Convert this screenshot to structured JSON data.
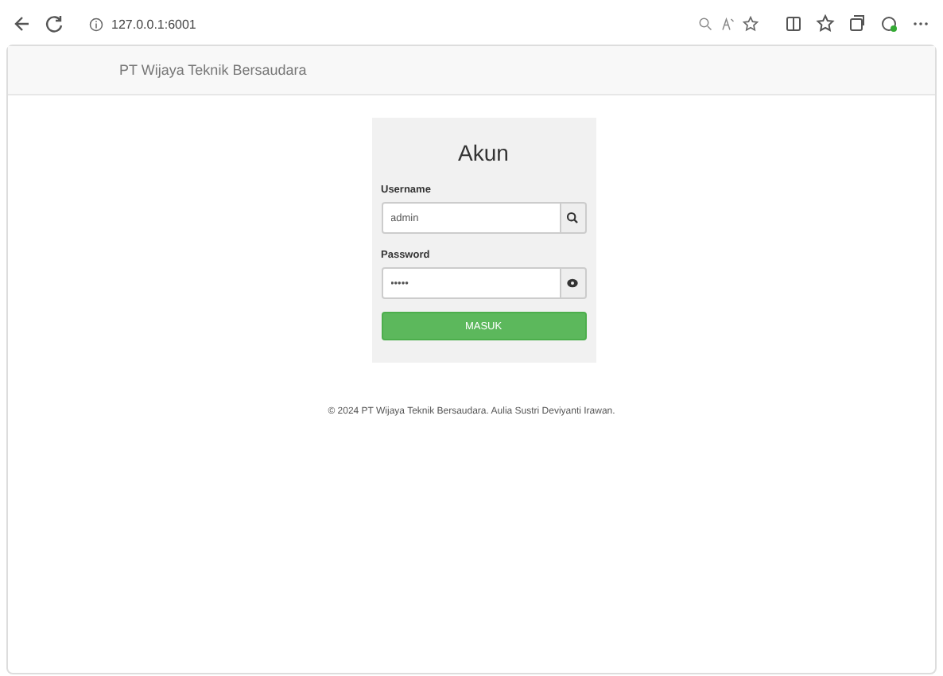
{
  "browser": {
    "address": "127.0.0.1:6001"
  },
  "navbar": {
    "brand": "PT Wijaya Teknik Bersaudara"
  },
  "login": {
    "title": "Akun",
    "username_label": "Username",
    "username_value": "admin",
    "password_label": "Password",
    "password_value": "•••••",
    "submit": "MASUK"
  },
  "footer": "© 2024 PT Wijaya Teknik Bersaudara. Aulia Sustri Deviyanti Irawan."
}
